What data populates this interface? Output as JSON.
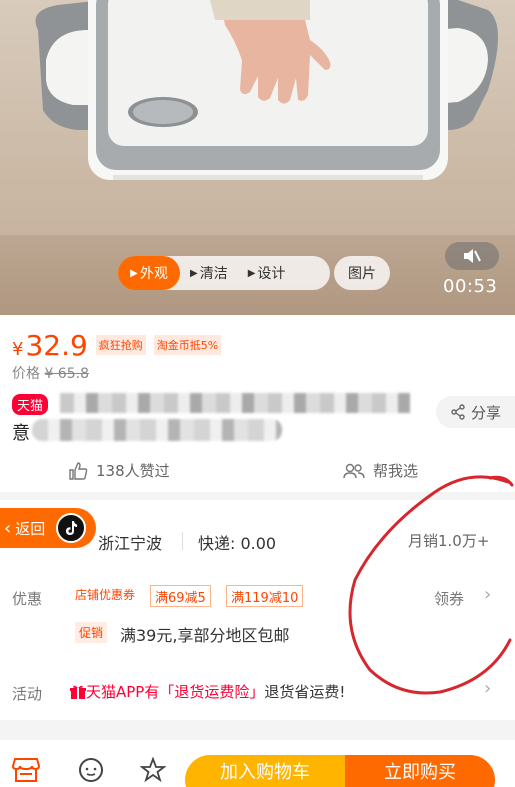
{
  "video": {
    "tabs": [
      {
        "label": "外观",
        "active": true
      },
      {
        "label": "清洁",
        "active": false
      },
      {
        "label": "设计",
        "active": false
      }
    ],
    "pictures_label": "图片",
    "duration": "00:53"
  },
  "product": {
    "currency": "¥",
    "price": "32.9",
    "tags": [
      "疯狂抢购",
      "淘金币抵5%"
    ],
    "original_price_label": "价格",
    "original_price": "¥ 65.8",
    "store_badge": "天猫",
    "title_visible_char": "意",
    "share_label": "分享",
    "likes": "138人赞过",
    "help_label": "帮我选"
  },
  "shipping": {
    "back_label": "返回",
    "origin": "浙江宁波",
    "fee": "快递: 0.00",
    "monthly_sales": "月销1.0万+"
  },
  "discount": {
    "label": "优惠",
    "store_coupon_tag": "店铺优惠券",
    "coupons": [
      "满69减5",
      "满119减10"
    ],
    "collect_label": "领券",
    "promo_tag": "促销",
    "promo_text": "满39元,享部分地区包邮"
  },
  "activity": {
    "label": "活动",
    "highlight": "天猫APP有「退货运费险」",
    "text": "退货省运费!"
  },
  "actions": {
    "add_to_cart": "加入购物车",
    "buy_now": "立即购买"
  },
  "colors": {
    "accent": "#ff6a00",
    "price": "#ff4400",
    "tmall_red": "#ff0036",
    "cart_yellow": "#ffb400"
  }
}
